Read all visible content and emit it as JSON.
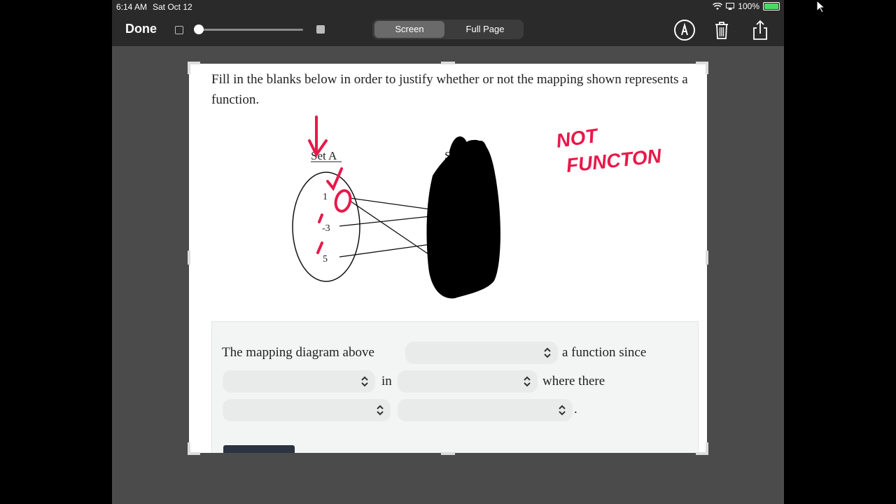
{
  "status_bar": {
    "time": "6:14 AM",
    "date": "Sat Oct 12",
    "battery": "100%"
  },
  "toolbar": {
    "done_label": "Done",
    "tabs": [
      {
        "label": "Screen",
        "selected": true
      },
      {
        "label": "Full Page",
        "selected": false
      }
    ],
    "icons": [
      "markup-pen-icon",
      "trash-icon",
      "share-icon"
    ]
  },
  "document": {
    "prompt": "Fill in the blanks below in order to justify whether or not the mapping shown represents a function.",
    "diagram": {
      "set_a_label": "Set A",
      "set_b_label_partial": "S",
      "set_a_values": [
        "1",
        "-3",
        "5"
      ]
    },
    "annotation": {
      "line1": "NOT",
      "line2": "FUNCTON"
    },
    "answer": {
      "text1": "The mapping diagram above",
      "text2": "a function since",
      "text3": "in",
      "text4": "where there",
      "text5": "."
    }
  },
  "colors": {
    "annotation_red": "#e8194a",
    "toolbar_bg": "#2a2a2a"
  }
}
